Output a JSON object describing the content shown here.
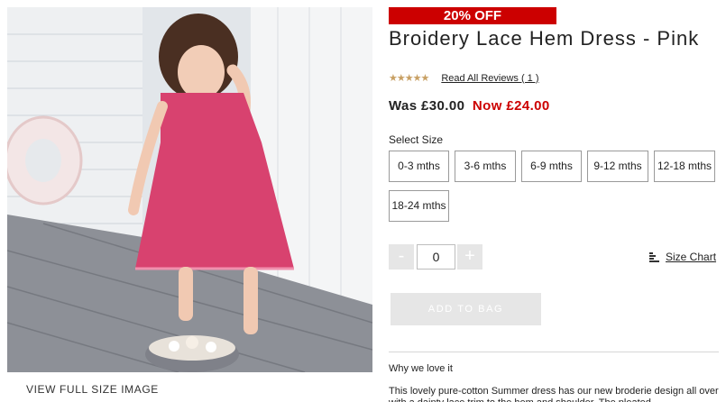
{
  "image": {
    "view_full_label": "VIEW FULL SIZE IMAGE"
  },
  "product": {
    "badge": "20% OFF",
    "title": "Broidery Lace Hem Dress - Pink",
    "stars": "★★★★★",
    "rating_value": 5,
    "reviews_link": "Read All Reviews ( 1 )",
    "was_price": "Was £30.00",
    "now_price": "Now £24.00"
  },
  "size": {
    "label": "Select Size",
    "options": [
      "0-3 mths",
      "3-6 mths",
      "6-9 mths",
      "9-12 mths",
      "12-18 mths",
      "18-24 mths"
    ]
  },
  "quantity": {
    "minus": "-",
    "value": "0",
    "plus": "+"
  },
  "size_chart": {
    "label": "Size Chart",
    "icon": "size-chart-icon"
  },
  "add_to_bag": "ADD TO BAG",
  "details": {
    "heading": "Why we love it",
    "description": "This lovely pure-cotton Summer dress has our new broderie design all over with a dainty lace trim to the hem and shoulder. The pleated"
  },
  "colors": {
    "sale_red": "#cc0000",
    "star_gold": "#c8a064",
    "disabled_grey": "#e6e6e6"
  }
}
